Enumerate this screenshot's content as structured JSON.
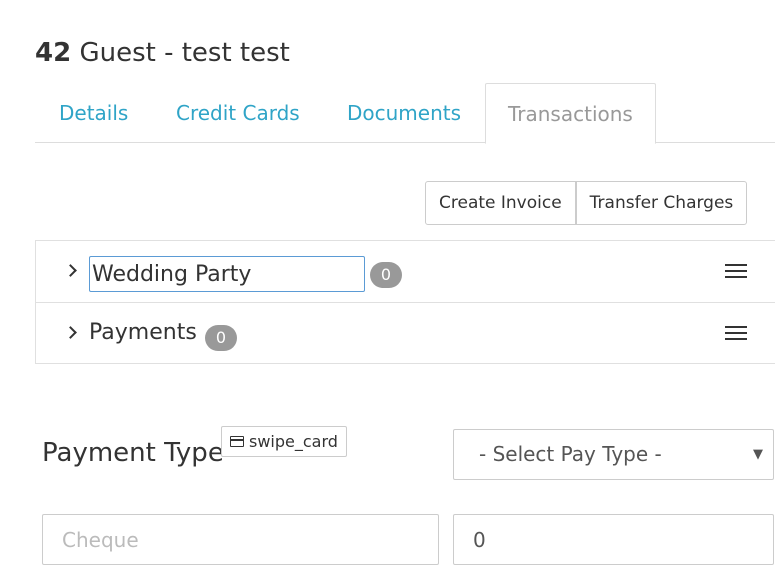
{
  "header": {
    "guest_number": "42",
    "guest_title": " Guest - test test"
  },
  "tabs": [
    {
      "label": "Details"
    },
    {
      "label": "Credit Cards"
    },
    {
      "label": "Documents"
    },
    {
      "label": "Transactions"
    }
  ],
  "actions": {
    "create_invoice": "Create Invoice",
    "transfer_charges": "Transfer Charges"
  },
  "groups": [
    {
      "name": "Wedding Party",
      "count": "0",
      "editable": true
    },
    {
      "name": "Payments",
      "count": "0",
      "editable": false
    }
  ],
  "payment": {
    "label": "Payment Type",
    "swipe_label": "swipe_card",
    "select_value": "- Select Pay Type -",
    "reference_placeholder": "Cheque",
    "amount_value": "0"
  },
  "colors": {
    "link": "#2fa4c7",
    "badge": "#999999",
    "focus_border": "#5b9bd5"
  }
}
